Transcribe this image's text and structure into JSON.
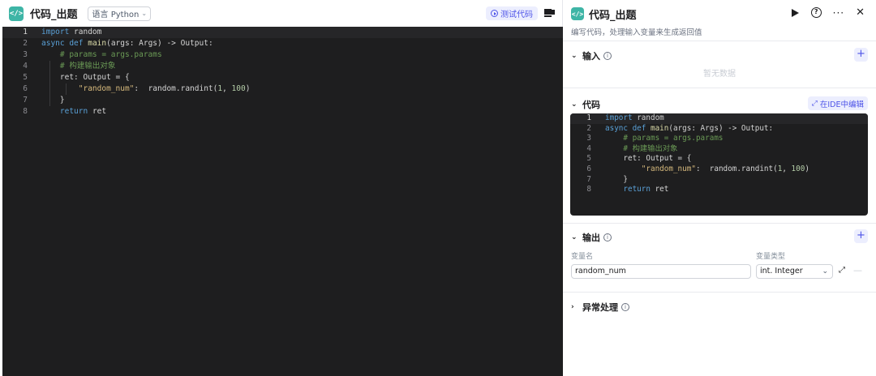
{
  "left": {
    "icon_text": "</>",
    "title": "代码_出题",
    "language_select": "语言 Python",
    "test_button_label": "测试代码"
  },
  "code_lines": [
    {
      "n": "1",
      "html": "<span class=\"kw\">import</span> random"
    },
    {
      "n": "2",
      "html": "<span class=\"kw\">async def</span> <span class=\"fn\">main</span>(args: Args) -&gt; Output:"
    },
    {
      "n": "3",
      "html": "    <span class=\"cm\"># params = args.params</span>"
    },
    {
      "n": "4",
      "html": "    <span class=\"cm\"># 构建输出对象</span>"
    },
    {
      "n": "5",
      "html": "    ret: Output = {"
    },
    {
      "n": "6",
      "html": "        <span class=\"st\">\"random_num\"</span>:  random.randint(<span class=\"nm\">1</span>, <span class=\"nm\">100</span>)"
    },
    {
      "n": "7",
      "html": "    }"
    },
    {
      "n": "8",
      "html": "    <span class=\"kw\">return</span> ret"
    }
  ],
  "panel": {
    "icon_text": "</>",
    "title": "代码_出题",
    "description": "编写代码，处理输入变量来生成返回值",
    "input_section": {
      "title": "输入",
      "empty_text": "暂无数据"
    },
    "code_section": {
      "title": "代码",
      "ide_button_label": "在IDE中编辑"
    },
    "output_section": {
      "title": "输出",
      "col_var_name": "变量名",
      "col_var_type": "变量类型",
      "variable_name": "random_num",
      "variable_type": "int. Integer"
    },
    "exception_section": {
      "title": "异常处理"
    }
  },
  "colors": {
    "accent": "#4d53e8",
    "accent_bg": "#eceefe",
    "code_badge": "#3eb5a6",
    "editor_bg": "#1e1e1f"
  }
}
